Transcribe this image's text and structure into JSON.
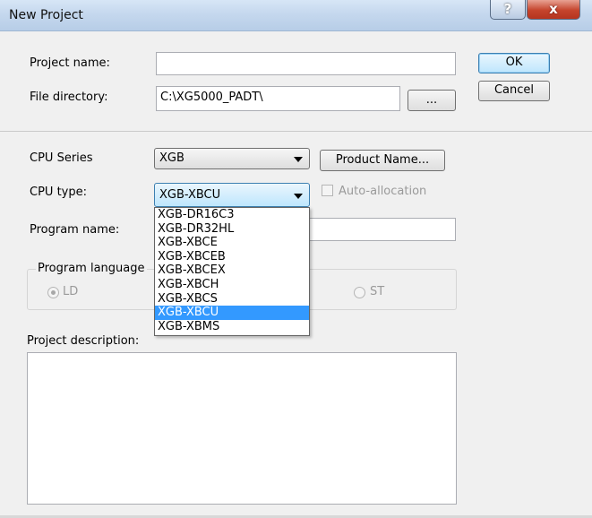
{
  "window": {
    "title": "New Project",
    "help_label": "?",
    "close_label": "x"
  },
  "form": {
    "project_name_label": "Project name:",
    "project_name_value": "",
    "file_directory_label": "File directory:",
    "file_directory_value": "C:\\XG5000_PADT\\",
    "browse_label": "...",
    "cpu_series_label": "CPU Series",
    "cpu_series_value": "XGB",
    "product_name_label": "Product Name...",
    "cpu_type_label": "CPU type:",
    "cpu_type_value": "XGB-XBCU",
    "auto_allocation_label": "Auto-allocation",
    "program_name_label": "Program name:",
    "program_name_value": "",
    "program_language_label": "Program language",
    "lang_ld_label": "LD",
    "lang_st_label": "ST",
    "project_description_label": "Project description:"
  },
  "buttons": {
    "ok_label": "OK",
    "cancel_label": "Cancel"
  },
  "cpu_type_options": [
    "XGB-DR16C3",
    "XGB-DR32HL",
    "XGB-XBCE",
    "XGB-XBCEB",
    "XGB-XBCEX",
    "XGB-XBCH",
    "XGB-XBCS",
    "XGB-XBCU",
    "XGB-XBMS"
  ],
  "cpu_type_selected": "XGB-XBCU"
}
